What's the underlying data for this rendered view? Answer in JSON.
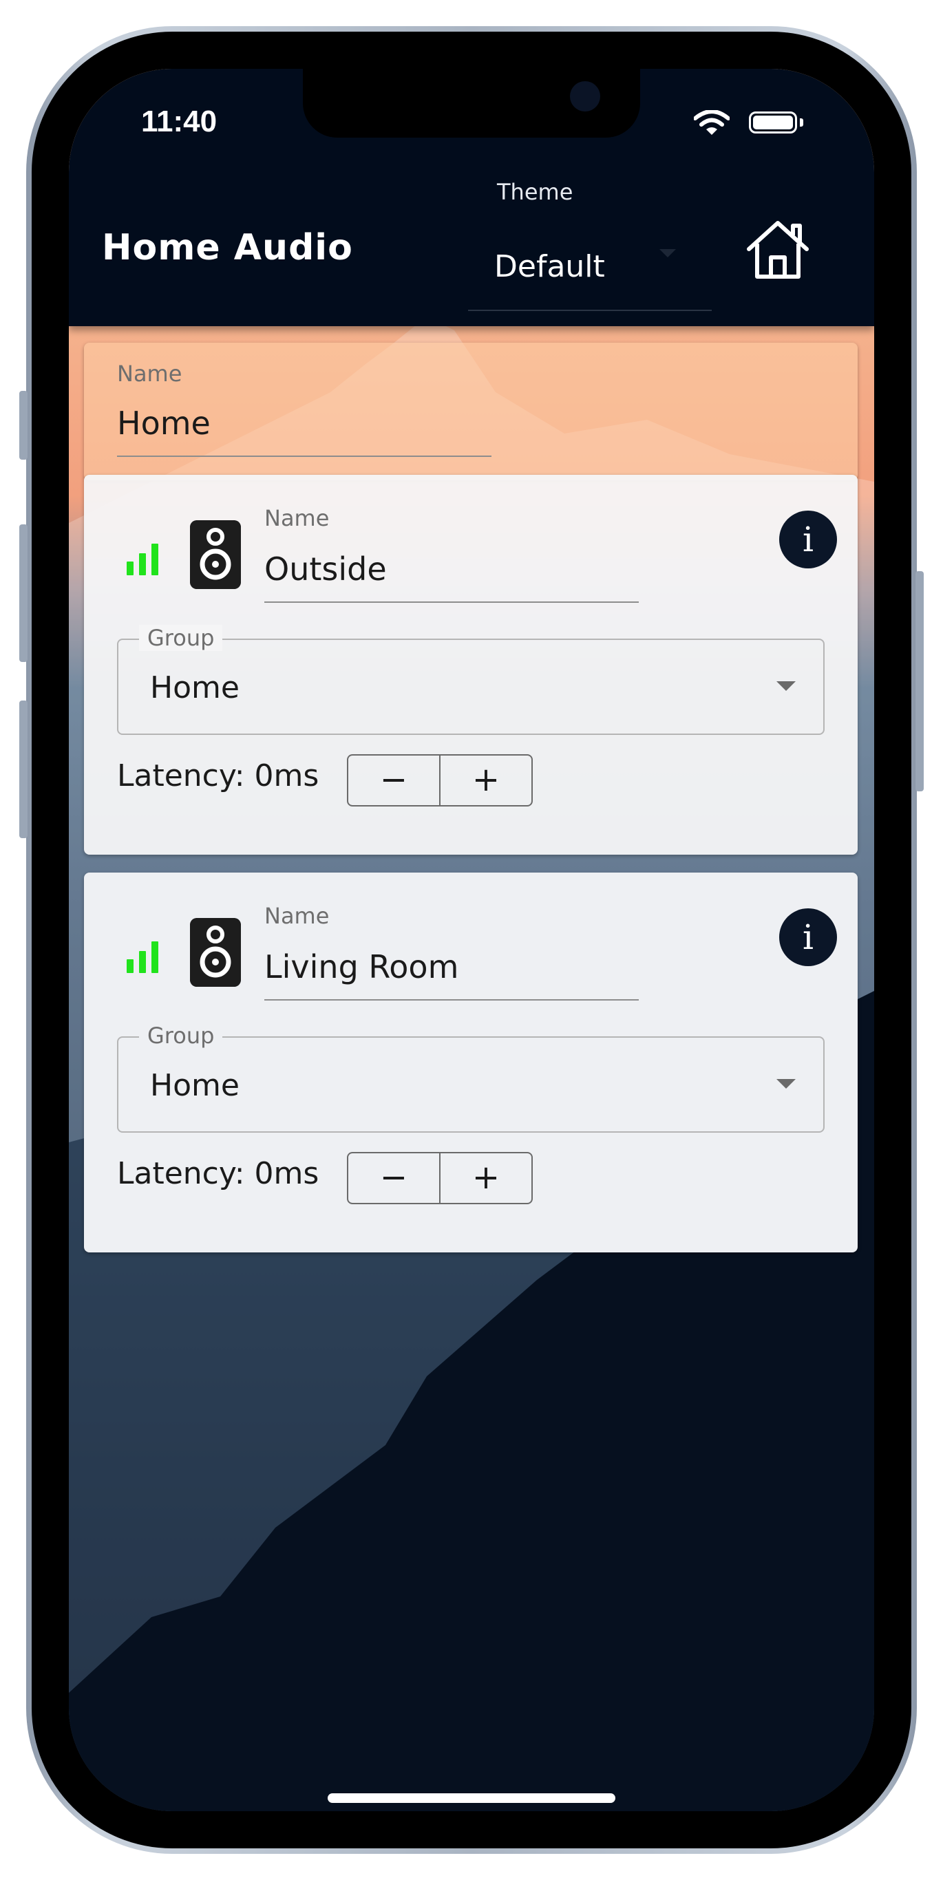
{
  "status_bar": {
    "time": "11:40"
  },
  "app_bar": {
    "title": "Home Audio",
    "theme": {
      "label": "Theme",
      "value": "Default"
    },
    "home_icon": "home-icon"
  },
  "group": {
    "name_label": "Name",
    "name_value": "Home"
  },
  "speakers": [
    {
      "name_label": "Name",
      "name_value": "Outside",
      "group_label": "Group",
      "group_value": "Home",
      "latency": "Latency: 0ms",
      "minus": "−",
      "plus": "+",
      "info": "i",
      "signal_level": 1.0
    },
    {
      "name_label": "Name",
      "name_value": "Living Room",
      "group_label": "Group",
      "group_value": "Home",
      "latency": "Latency: 0ms",
      "minus": "−",
      "plus": "+",
      "info": "i",
      "signal_level": 1.0
    }
  ],
  "colors": {
    "app_bar": "#020c1c",
    "signal": "#21e31c",
    "info_button": "#0b1628"
  }
}
